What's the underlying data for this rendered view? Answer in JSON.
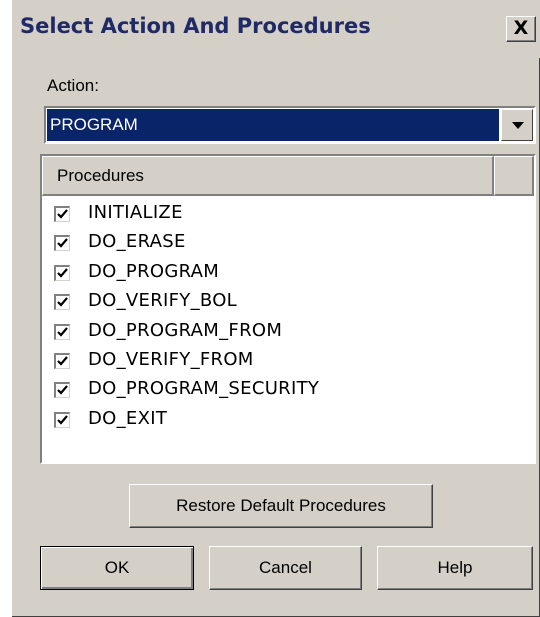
{
  "window": {
    "title": "Select Action And Procedures",
    "close_label": "X"
  },
  "action": {
    "label": "Action:",
    "selected": "PROGRAM"
  },
  "procedures": {
    "column_header": "Procedures",
    "items": [
      {
        "label": "INITIALIZE",
        "checked": true
      },
      {
        "label": "DO_ERASE",
        "checked": true
      },
      {
        "label": "DO_PROGRAM",
        "checked": true
      },
      {
        "label": "DO_VERIFY_BOL",
        "checked": true
      },
      {
        "label": "DO_PROGRAM_FROM",
        "checked": true
      },
      {
        "label": "DO_VERIFY_FROM",
        "checked": true
      },
      {
        "label": "DO_PROGRAM_SECURITY",
        "checked": true
      },
      {
        "label": "DO_EXIT",
        "checked": true
      }
    ]
  },
  "buttons": {
    "restore": "Restore Default Procedures",
    "ok": "OK",
    "cancel": "Cancel",
    "help": "Help"
  },
  "colors": {
    "dialog_bg": "#d4d0c8",
    "selection": "#0a246a",
    "title_text": "#1f2a66"
  }
}
